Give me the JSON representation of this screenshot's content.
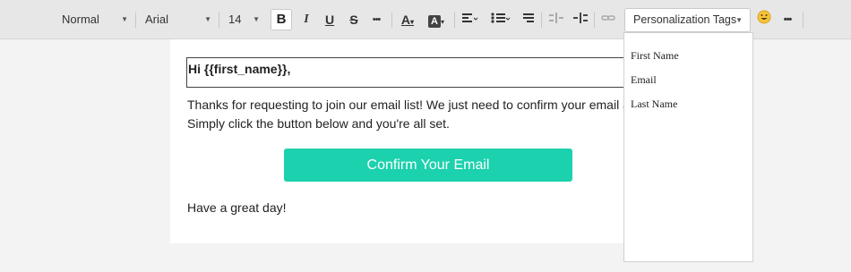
{
  "toolbar": {
    "paragraph_style": "Normal",
    "font_family": "Arial",
    "font_size": "14",
    "bold": "B",
    "italic": "I",
    "underline": "U",
    "strikethrough": "S",
    "more_formatting": "•••",
    "text_color": "A",
    "highlight_color": "A",
    "personalization_tags": "Personalization Tags",
    "more": "•••"
  },
  "email": {
    "greeting": "Hi {{first_name}},",
    "body_line1": "Thanks for requesting to join our email list! We just need to confirm your email address.",
    "body_line2": "Simply click the button below and you're all set.",
    "button_label": "Confirm Your Email",
    "signoff": "Have a great day!"
  },
  "personalization_menu": {
    "items": [
      "First Name",
      "Email",
      "Last Name"
    ]
  },
  "colors": {
    "button": "#1cd1ad",
    "toolbar_bg": "#e7e7e7"
  }
}
